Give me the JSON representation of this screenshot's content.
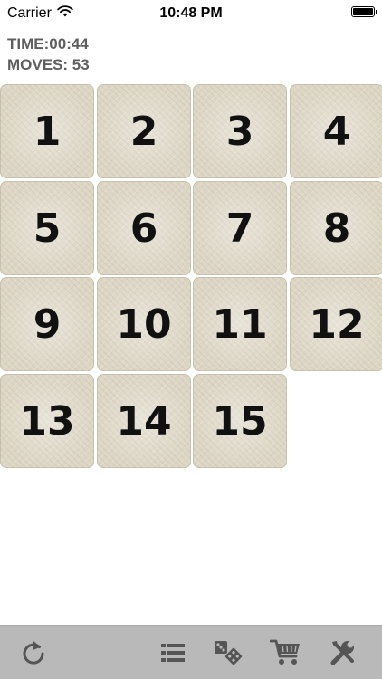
{
  "status_bar": {
    "carrier": "Carrier",
    "time": "10:48 PM",
    "battery_level": 1.0
  },
  "game": {
    "time_label": "TIME:",
    "time_value": "00:44",
    "moves_label": "MOVES:",
    "moves_value": "53",
    "tiles": [
      "1",
      "2",
      "3",
      "4",
      "5",
      "6",
      "7",
      "8",
      "9",
      "10",
      "11",
      "12",
      "13",
      "14",
      "15"
    ]
  },
  "toolbar": {
    "icons": [
      "refresh-icon",
      "list-icon",
      "dice-icon",
      "cart-icon",
      "tools-icon"
    ]
  },
  "colors": {
    "tile": "#ddd6c5",
    "toolbar": "#b9b9b9",
    "info_text": "#5f5f5f",
    "icon": "#555555"
  }
}
